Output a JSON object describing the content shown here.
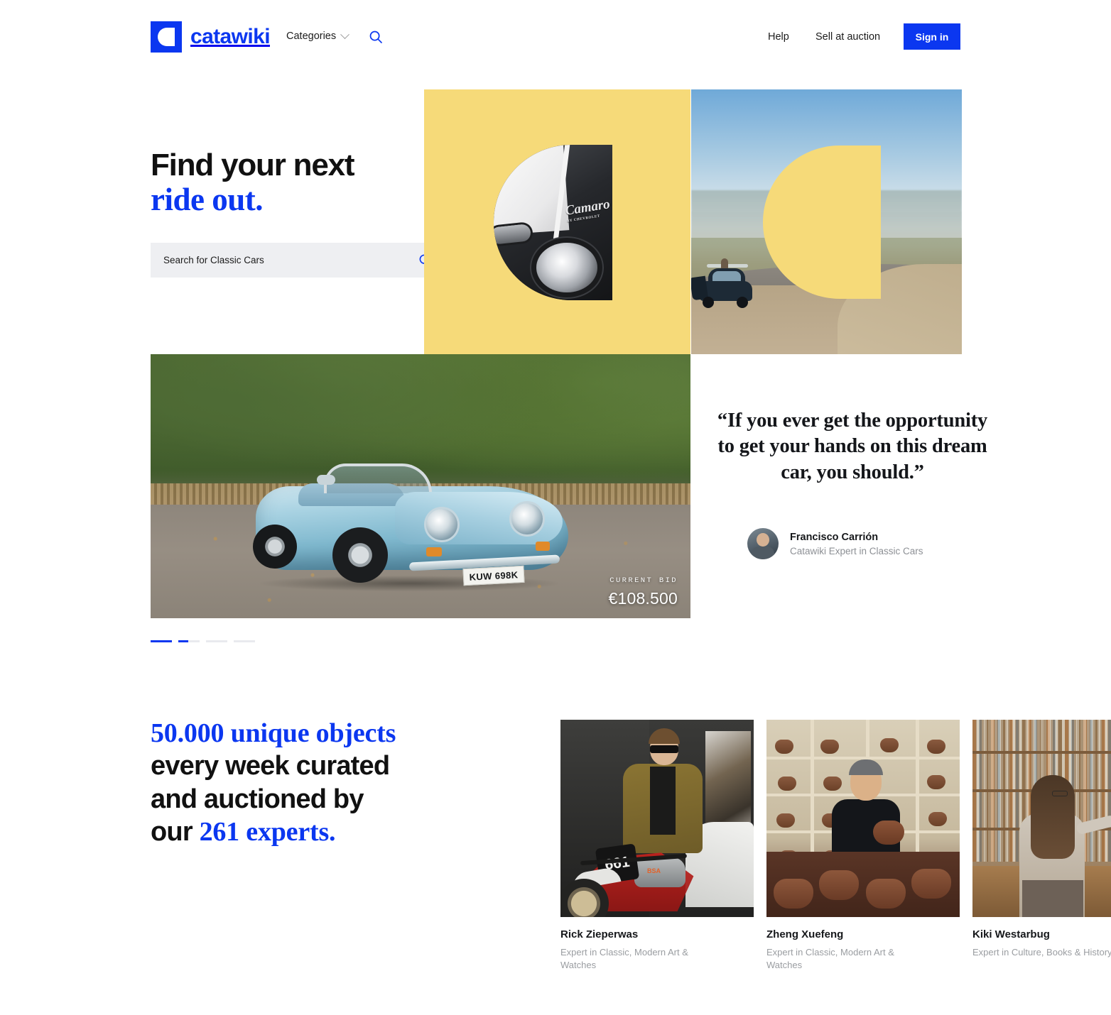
{
  "brand": {
    "name": "catawiki",
    "blue": "#0B37F0",
    "yellow": "#F6DA79",
    "search_bg": "#EEEFF2",
    "logo_icon": "catawiki-d-mark"
  },
  "header": {
    "categories_label": "Categories",
    "categories_chevron": "chevron-down-icon",
    "search_icon": "search-icon",
    "help_label": "Help",
    "sell_label": "Sell at auction",
    "signin_label": "Sign in"
  },
  "hero": {
    "heading_line1": "Find your next",
    "heading_line2": "ride out.",
    "search": {
      "placeholder": "Search for Classic Cars",
      "value": "",
      "submit_icon": "search-icon"
    },
    "images": {
      "camaro": {
        "alt": "Chevrolet Camaro front headlight detail",
        "badge_script": "Camaro",
        "badge_sub": "BY CHEVROLET"
      },
      "beetle": {
        "alt": "Volkswagen Beetle parked on a coastal dirt road"
      },
      "porsche": {
        "alt": "Light blue Porsche 356 Speedster convertible parked under trees",
        "plate": "KUW 698K"
      }
    },
    "listing": {
      "bid_label": "CURRENT BID",
      "bid_amount": "€108.500"
    },
    "quote": {
      "text": "“If you ever get the opportunity to get your hands on this dream car, you should.”",
      "author_name": "Francisco Carrión",
      "author_role": "Catawiki Expert in Classic Cars",
      "author_avatar": "expert-avatar"
    },
    "carousel": {
      "slides": [
        {
          "state": "active"
        },
        {
          "state": "partial"
        },
        {
          "state": "inactive"
        },
        {
          "state": "inactive"
        }
      ]
    }
  },
  "experts_section": {
    "heading": {
      "part1": "50.000 unique objects",
      "part2": "every week curated",
      "part3": "and auctioned by",
      "part4_prefix": "our ",
      "part4_highlight": "261 experts."
    },
    "cards": [
      {
        "name": "Rick Zieperwas",
        "role": "Expert in Classic, Modern Art & Watches",
        "photo_alt": "Man in olive jacket sitting on a vintage BSA motorcycle",
        "photo_number": "661"
      },
      {
        "name": "Zheng Xuefeng",
        "role": "Expert in Classic, Modern Art & Watches",
        "photo_alt": "Man holding a Yixing clay teapot in a room full of teapot shelves"
      },
      {
        "name": "Kiki Westarbug",
        "role": "Expert in Culture, Books & History",
        "photo_alt": "Woman browsing shelves in a bookshop"
      }
    ]
  }
}
